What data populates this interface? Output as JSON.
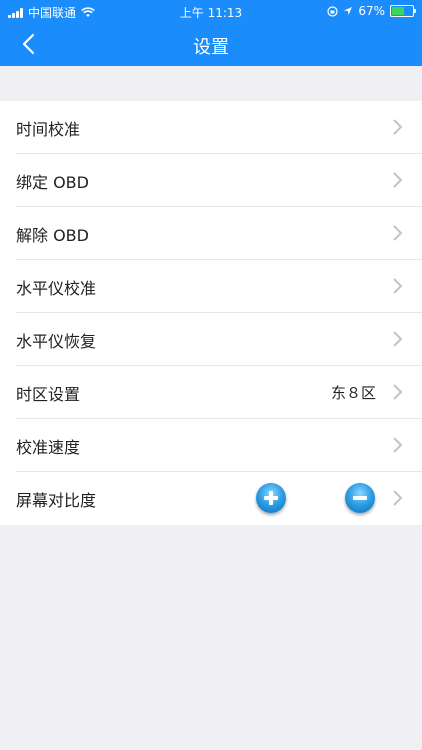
{
  "status_bar": {
    "carrier": "中国联通",
    "time": "上午 11:13",
    "battery": "67%",
    "battery_level": 0.67
  },
  "nav": {
    "title": "设置",
    "back_icon": "chevron-left-icon"
  },
  "settings": [
    {
      "label": "时间校准"
    },
    {
      "label": "绑定 OBD"
    },
    {
      "label": "解除 OBD"
    },
    {
      "label": "水平仪校准"
    },
    {
      "label": "水平仪恢复"
    },
    {
      "label": "时区设置",
      "value": "东８区"
    },
    {
      "label": "校准速度"
    },
    {
      "label": "屏幕对比度"
    }
  ],
  "colors": {
    "accent": "#1a8cfb",
    "background": "#efeff4"
  }
}
